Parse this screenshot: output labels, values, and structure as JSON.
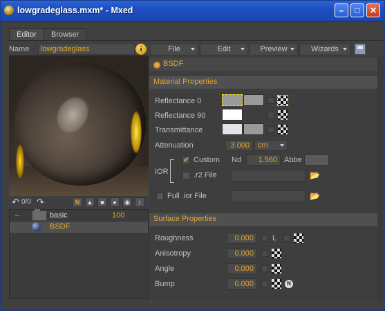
{
  "window": {
    "title": "lowgradeglass.mxm* - Mxed",
    "minimize_glyph": "–",
    "maximize_glyph": "□",
    "close_glyph": "✕"
  },
  "tabs": [
    {
      "label": "Editor",
      "active": true
    },
    {
      "label": "Browser",
      "active": false
    }
  ],
  "name_row": {
    "label": "Name",
    "value": "lowgradeglass",
    "info_glyph": "i"
  },
  "menus": [
    {
      "label": "File"
    },
    {
      "label": "Edit"
    },
    {
      "label": "Preview"
    },
    {
      "label": "Wizards"
    }
  ],
  "preview_toolbar": {
    "undo_counter": "0/0",
    "n_label": "N"
  },
  "tree": [
    {
      "label": "basic",
      "value": "100",
      "expand_glyph": "–"
    },
    {
      "label": "BSDF",
      "value": ""
    }
  ],
  "bsdf_header": "BSDF",
  "material_properties": {
    "title": "Material Properties",
    "reflectance0": "Reflectance 0",
    "reflectance90": "Reflectance 90",
    "transmittance": "Transmittance",
    "attenuation": {
      "label": "Attenuation",
      "value": "3.000",
      "unit": "cm"
    },
    "ior": {
      "label": "IOR",
      "custom_label": "Custom",
      "custom_checked": true,
      "nd_label": "Nd",
      "nd_value": "1.560",
      "abbe_label": "Abbe",
      "r2_label": ".r2 File",
      "r2_checked": false
    },
    "full_ior": {
      "label": "Full .ior File",
      "checked": false
    }
  },
  "surface_properties": {
    "title": "Surface Properties",
    "roughness": {
      "label": "Roughness",
      "value": "0.000",
      "l_label": "L"
    },
    "anisotropy": {
      "label": "Anisotropy",
      "value": "0.000"
    },
    "angle": {
      "label": "Angle",
      "value": "0.000"
    },
    "bump": {
      "label": "Bump",
      "value": "0.000",
      "n_label": "N"
    }
  },
  "colors": {
    "accent": "#e0a534",
    "swatch_white": "#ffffff",
    "swatch_light": "#e4e4e4",
    "swatch_gray": "#9a9a9a"
  }
}
